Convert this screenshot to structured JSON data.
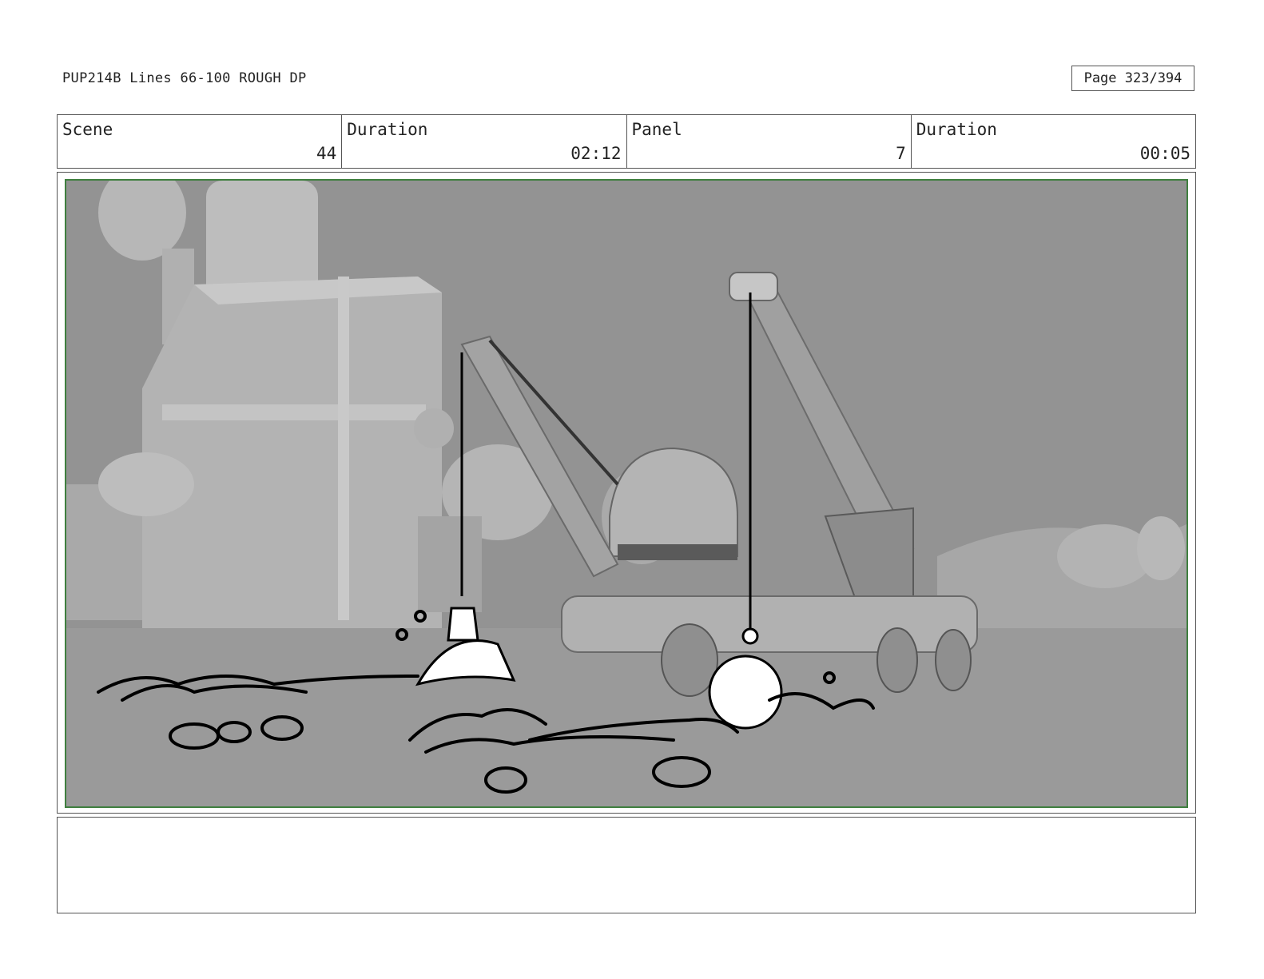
{
  "header": {
    "doc_title": "PUP214B Lines 66-100 ROUGH DP",
    "page_label": "Page 323/394"
  },
  "info": {
    "scene_label": "Scene",
    "scene_value": "44",
    "scene_duration_label": "Duration",
    "scene_duration_value": "02:12",
    "panel_label": "Panel",
    "panel_value": "7",
    "panel_duration_label": "Duration",
    "panel_duration_value": "00:05"
  },
  "notes": {
    "text": ""
  }
}
